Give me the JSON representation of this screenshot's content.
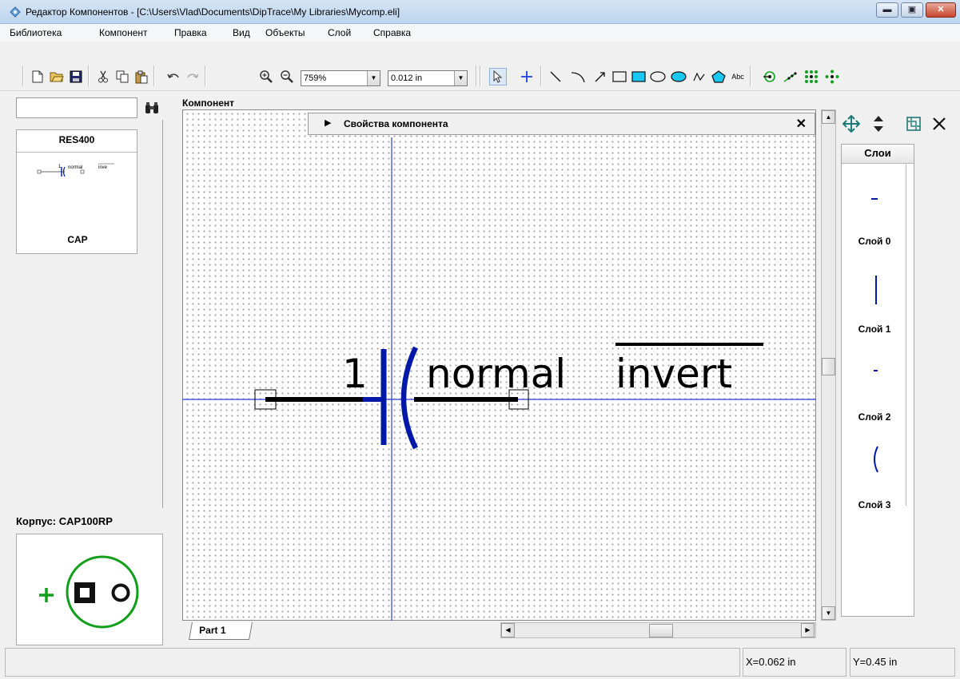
{
  "window": {
    "title": "Редактор Компонентов - [C:\\Users\\Vlad\\Documents\\DipTrace\\My Libraries\\Mycomp.eli]",
    "minimize_glyph": "▬",
    "maximize_glyph": "▣",
    "close_glyph": "✕"
  },
  "menu": {
    "items": [
      "Библиотека",
      "Компонент",
      "Правка",
      "Вид",
      "Объекты",
      "Слой",
      "Справка"
    ]
  },
  "toolbar": {
    "zoom_value": "759%",
    "grid_value": "0.012 in",
    "text_tool_label": "Abc"
  },
  "library": {
    "search_value": "",
    "selected_component": "RES400",
    "preview_component": "CAP",
    "package_label": "Корпус: CAP100RP"
  },
  "editor": {
    "section_label": "Компонент",
    "properties_title": "Свойства компонента",
    "properties_close": "✕",
    "tab_label": "Part 1",
    "pin_number": "1",
    "pin_name": "normal",
    "pin_inverted_name": "invert"
  },
  "layers": {
    "header": "Слои",
    "items": [
      {
        "name": "Слой 0",
        "preview": "short-dash"
      },
      {
        "name": "Слой 1",
        "preview": "vertical-line"
      },
      {
        "name": "Слой 2",
        "preview": "tiny-dash"
      },
      {
        "name": "Слой 3",
        "preview": "arc"
      }
    ]
  },
  "status": {
    "x_coord": "X=0.062 in",
    "y_coord": "Y=0.45 in"
  },
  "colors": {
    "layer_blue": "#0018a8",
    "pin_black": "#000000",
    "package_green": "#119e1a",
    "crosshair": "#2a3bd8"
  },
  "icons": {
    "app": "diamond-eye-icon",
    "search": "binoculars-icon",
    "move": "move-arrows-icon",
    "flip_vertical": "up-down-arrows-icon",
    "fit": "fit-frame-icon",
    "delete": "x-icon"
  }
}
